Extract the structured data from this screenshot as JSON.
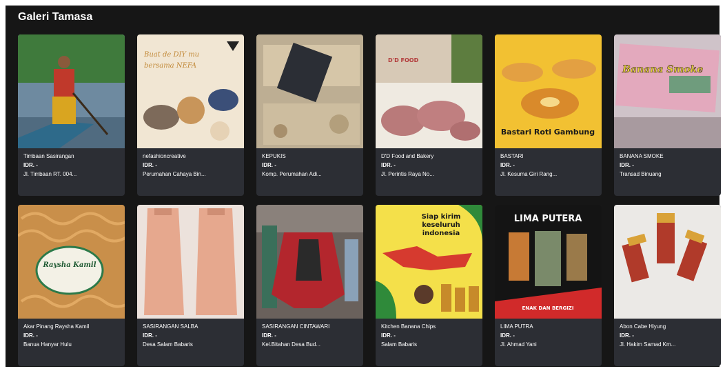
{
  "gallery": {
    "title": "Galeri Tamasa",
    "items": [
      {
        "name": "Timbaan Sasirangan",
        "price": "IDR. -",
        "address": "Jl. Timbaan RT. 004...",
        "bg": "#3d6b3a"
      },
      {
        "name": "nefashioncreative",
        "price": "IDR. -",
        "address": "Perumahan Cahaya Bin...",
        "bg": "#efe3cf",
        "thumb_text": [
          "Buat de DIY mu",
          "bersama NEFA"
        ]
      },
      {
        "name": "KEPUKIS",
        "price": "IDR. -",
        "address": "Komp. Perumahan Adi...",
        "bg": "#b9a98c"
      },
      {
        "name": "D'D Food and Bakery",
        "price": "IDR. -",
        "address": "Jl. Perintis Raya No...",
        "bg": "#c9b7a2",
        "thumb_text": [
          "D'D FOOD"
        ]
      },
      {
        "name": "BASTARI",
        "price": "IDR. -",
        "address": "Jl. Kesuma Giri Rang...",
        "bg": "#f2c132",
        "thumb_text": [
          "Bastari Roti Gambung"
        ]
      },
      {
        "name": "BANANA SMOKE",
        "price": "IDR. -",
        "address": "Transad Binuang",
        "bg": "#d6c7cd",
        "thumb_text": [
          "Banana Smoke"
        ]
      },
      {
        "name": "Akar Pinang Raysha Kamil",
        "price": "IDR. -",
        "address": "Banua Hanyar Hulu",
        "bg": "#c98f4a",
        "thumb_text": [
          "Raysha Kamil"
        ]
      },
      {
        "name": "SASIRANGAN SALBA",
        "price": "IDR. -",
        "address": "Desa Salam Babaris",
        "bg": "#e6c9b8"
      },
      {
        "name": "SASIRANGAN CINTAWARI",
        "price": "IDR. -",
        "address": "Kel.Bitahan Desa Bud...",
        "bg": "#5b4f4a"
      },
      {
        "name": "Kitchen Banana Chips",
        "price": "IDR. -",
        "address": "Salam Babaris",
        "bg": "#f4e04a",
        "thumb_text": [
          "Siap kirim",
          "keseluruh",
          "indonesia"
        ]
      },
      {
        "name": "LIMA PUTRA",
        "price": "IDR. -",
        "address": "Jl. Ahmad Yani",
        "bg": "#1a1a1a",
        "thumb_text": [
          "LIMA PUTERA",
          "ENAK DAN BERGIZI"
        ]
      },
      {
        "name": "Abon Cabe Hiyung",
        "price": "IDR. -",
        "address": "Jl. Hakim Samad Km...",
        "bg": "#e9e7e3"
      }
    ]
  },
  "colors": {
    "frame_bg": "#161616",
    "card_bg": "#2c2e34",
    "text": "#ffffff"
  }
}
